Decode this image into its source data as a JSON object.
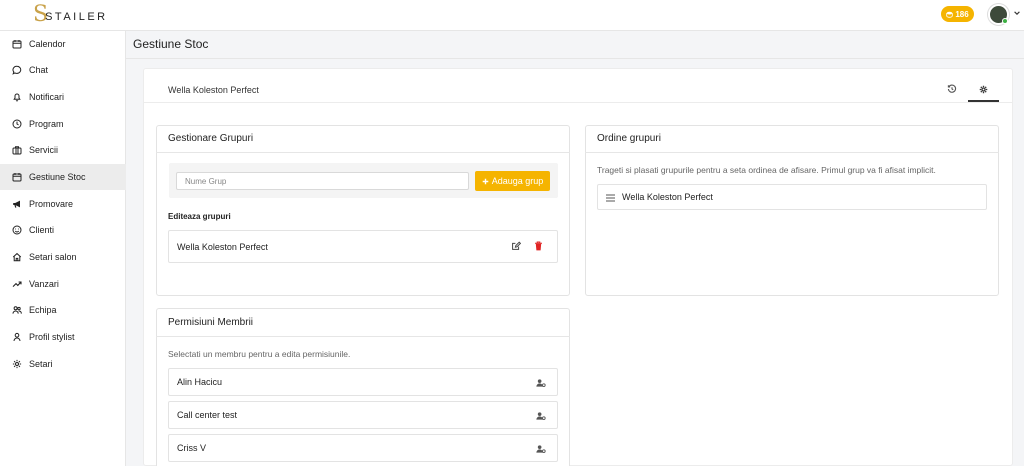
{
  "brand": {
    "logo_initial": "S",
    "logo_text": "STAILER"
  },
  "header": {
    "coins": "186"
  },
  "sidebar": {
    "items": [
      {
        "label": "Calendor",
        "icon": "calendar-icon"
      },
      {
        "label": "Chat",
        "icon": "chat-icon"
      },
      {
        "label": "Notificari",
        "icon": "bell-icon"
      },
      {
        "label": "Program",
        "icon": "clock-icon"
      },
      {
        "label": "Servicii",
        "icon": "briefcase-icon"
      },
      {
        "label": "Gestiune Stoc",
        "icon": "calendar-icon",
        "active": true
      },
      {
        "label": "Promovare",
        "icon": "megaphone-icon"
      },
      {
        "label": "Clienti",
        "icon": "smiley-icon"
      },
      {
        "label": "Setari salon",
        "icon": "home-icon"
      },
      {
        "label": "Vanzari",
        "icon": "trend-up-icon"
      },
      {
        "label": "Echipa",
        "icon": "team-icon"
      },
      {
        "label": "Profil stylist",
        "icon": "user-icon"
      },
      {
        "label": "Setari",
        "icon": "gear-icon"
      }
    ]
  },
  "page": {
    "title": "Gestiune Stoc",
    "tab_title": "Wella Koleston Perfect"
  },
  "groups_panel": {
    "title": "Gestionare Grupuri",
    "input_placeholder": "Nume Grup",
    "add_label": "Adauga grup",
    "edit_label": "Editeaza grupuri",
    "groups": [
      "Wella Koleston Perfect"
    ]
  },
  "order_panel": {
    "title": "Ordine grupuri",
    "description": "Trageti si plasati grupurile pentru a seta ordinea de afisare. Primul grup va fi afisat implicit.",
    "groups": [
      "Wella Koleston Perfect"
    ]
  },
  "members_panel": {
    "title": "Permisiuni Membrii",
    "description": "Selectati un membru pentru a edita permisiunile.",
    "members": [
      "Alin Hacicu",
      "Call center test",
      "Criss V"
    ]
  },
  "colors": {
    "accent": "#f5b400",
    "danger": "#e02424",
    "brand_gold": "#c9a24a"
  }
}
